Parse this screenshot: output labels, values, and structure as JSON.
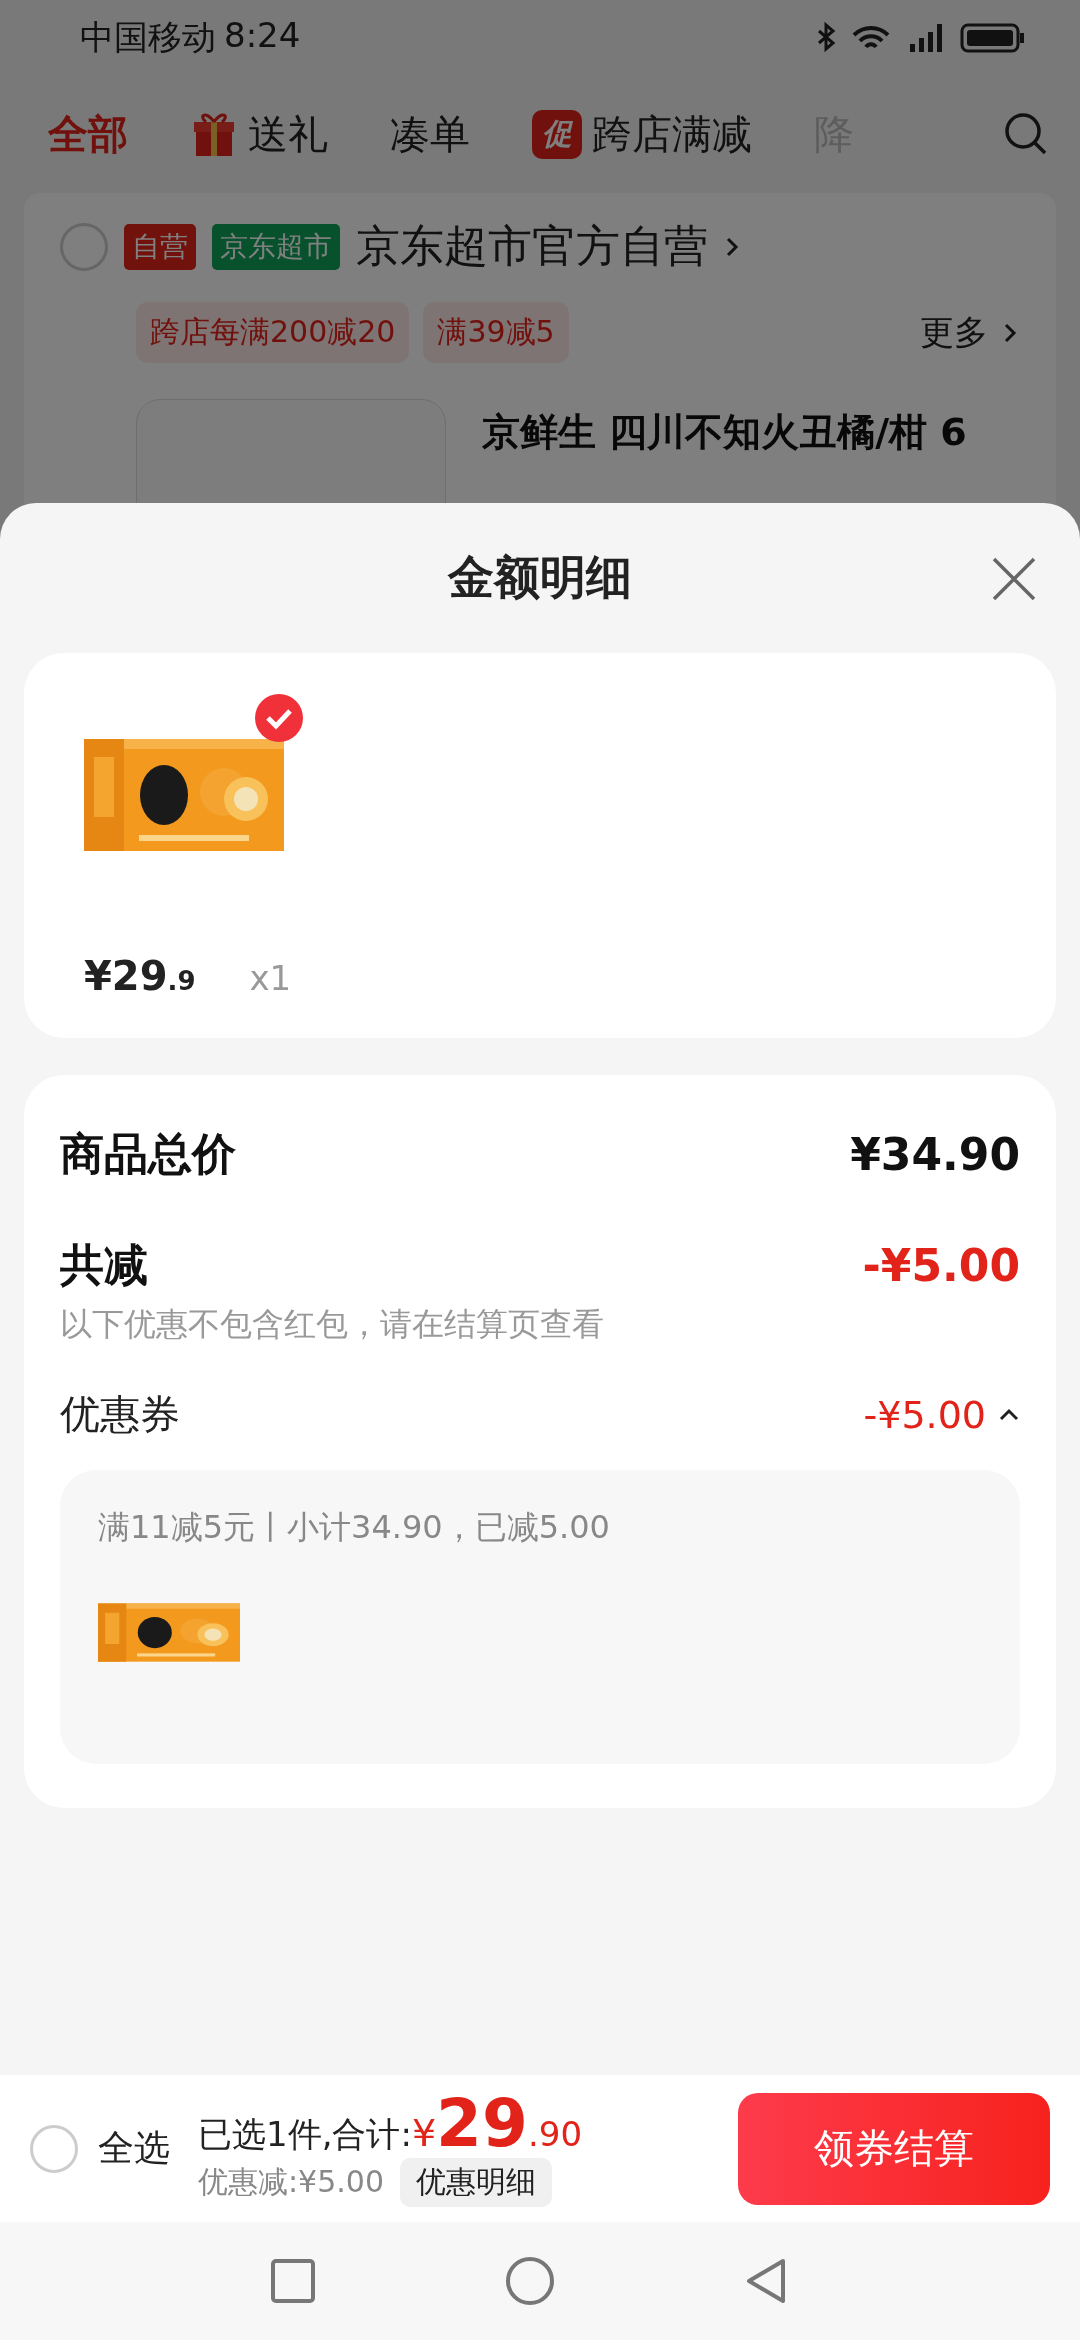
{
  "status_bar": {
    "carrier": "中国移动",
    "time": "8:24"
  },
  "tabs": [
    {
      "label": "全部",
      "kind": "plain",
      "selected": true
    },
    {
      "label": "送礼",
      "kind": "gift",
      "selected": false
    },
    {
      "label": "凑单",
      "kind": "plain",
      "selected": false
    },
    {
      "label": "跨店满减",
      "kind": "promo",
      "badge": "促",
      "selected": false
    },
    {
      "label": "降",
      "kind": "faded",
      "selected": false
    }
  ],
  "shop": {
    "checked": false,
    "tags": [
      {
        "text": "自营",
        "color": "#71120d"
      },
      {
        "text": "京东超市",
        "color": "#07522d"
      }
    ],
    "name": "京东超市官方自营",
    "promos": [
      "跨店每满200减20",
      "满39减5"
    ],
    "more": "更多",
    "product_title": "京鲜生 四川不知火丑橘/柑 6"
  },
  "sheet": {
    "title": "金额明细",
    "items": [
      {
        "kind": "picture",
        "checked": true,
        "price_main": "¥29",
        "price_decimal": ".9",
        "quantity": "x1"
      }
    ],
    "summary": {
      "total_label": "商品总价",
      "total_value": "¥34.90",
      "discount_label": "共减",
      "discount_value": "-¥5.00",
      "note": "以下优惠不包含红包，请在结算页查看",
      "coupon": {
        "label": "优惠券",
        "value": "-¥5.00",
        "expanded": true,
        "detail": "满11减5元丨小计34.90，已减5.00"
      }
    }
  },
  "bottom_bar": {
    "select_all": {
      "label": "全选",
      "checked": false
    },
    "selected_text": "已选1件,合计:",
    "currency": "¥",
    "total_main": "29",
    "total_decimal": ".90",
    "discount_text": "优惠减:¥5.00",
    "details_button": "优惠明细",
    "checkout_button": "领券结算"
  }
}
